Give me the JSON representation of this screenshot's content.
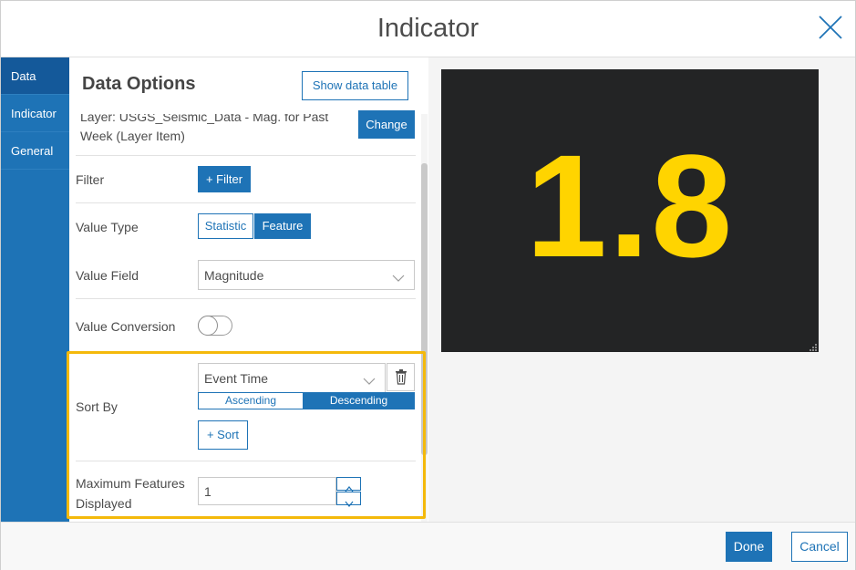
{
  "dialog": {
    "title": "Indicator"
  },
  "tabs": [
    {
      "label": "Data",
      "active": true
    },
    {
      "label": "Indicator",
      "active": false
    },
    {
      "label": "General",
      "active": false
    }
  ],
  "data_options": {
    "title": "Data Options",
    "show_table_label": "Show data table",
    "layer_text": "Layer: USGS_Seismic_Data - Mag. for Past Week (Layer Item)",
    "change_label": "Change",
    "filter": {
      "label": "Filter",
      "button": "+ Filter"
    },
    "value_type": {
      "label": "Value Type",
      "options": [
        "Statistic",
        "Feature"
      ],
      "selected": "Feature"
    },
    "value_field": {
      "label": "Value Field",
      "value": "Magnitude"
    },
    "value_conversion": {
      "label": "Value Conversion",
      "enabled": false
    },
    "sort_by": {
      "label": "Sort By",
      "field": "Event Time",
      "ascending": "Ascending",
      "descending": "Descending",
      "selected": "Descending",
      "add_sort": "+ Sort"
    },
    "max_features": {
      "label_line1": "Maximum Features",
      "label_line2": "Displayed",
      "value": "1"
    }
  },
  "preview": {
    "value": "1.8",
    "value_color": "#ffd400",
    "background": "#232425"
  },
  "footer": {
    "done": "Done",
    "cancel": "Cancel"
  },
  "colors": {
    "accent": "#1e73b6",
    "highlight": "#f4b90b"
  }
}
